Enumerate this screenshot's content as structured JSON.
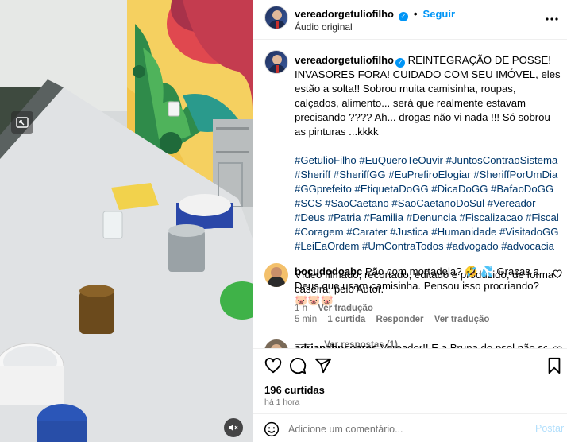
{
  "header": {
    "username": "vereadorgetuliofilho",
    "follow_label": "Seguir",
    "audio": "Áudio original"
  },
  "caption": {
    "username": "vereadorgetuliofilho",
    "text": "REINTEGRAÇÃO DE POSSE! INVASORES FORA! CUIDADO COM SEU IMÓVEL, eles estão a solta!! Sobrou muita camisinha, roupas, calçados, alimento... será que realmente estavam precisando ???? Ah... drogas não vi nada !!! Só sobrou as pinturas ...kkkk",
    "hashtags": "#GetulioFilho #EuQueroTeOuvir #JuntosContraoSistema #Sheriff #SheriffGG #EuPrefiroElogiar #SheriffPorUmDia #GGprefeito #EtiquetaDoGG #DicaDoGG #BafaoDoGG #SCS #SaoCaetano #SaoCaetanoDoSul #Vereador #Deus #Patria #Familia #Denuncia #Fiscalizacao #Fiscal #Coragem #Carater #Justica #Humanidade #VisitadoGG #LeiEaOrdem #UmContraTodos #advogado #advocacia",
    "footer": "Vídeo filmado, recortado, editado e produzido, de forma caseira, pelo Autor.",
    "time": "1 h",
    "translate": "Ver tradução"
  },
  "comments": [
    {
      "username": "bocudodoabc",
      "text": "Pão com mortadela? 🤣 💦 Graças a Deus que usam camisinha. Pensou isso procriando? 🐷🐷🐷",
      "time": "5 min",
      "likes": "1 curtida",
      "reply": "Responder",
      "translate": "Ver tradução",
      "view_replies": "Ver respostas (1)"
    },
    {
      "username": "adrianahpsoares",
      "text": "Vereador!! E a Bruna do psol não sofrerá"
    }
  ],
  "post_stats": {
    "likes": "196 curtidas",
    "time": "há 1 hora"
  },
  "comment_input": {
    "placeholder": "Adicione um comentário...",
    "post_label": "Postar"
  },
  "icons": [
    "more-icon",
    "heart-icon",
    "comment-icon",
    "share-icon",
    "bookmark-icon",
    "emoji-icon",
    "pip-icon",
    "mute-icon"
  ],
  "colors": {
    "accent": "#0095f6",
    "hashtag": "#00376b",
    "muted": "#737373"
  }
}
